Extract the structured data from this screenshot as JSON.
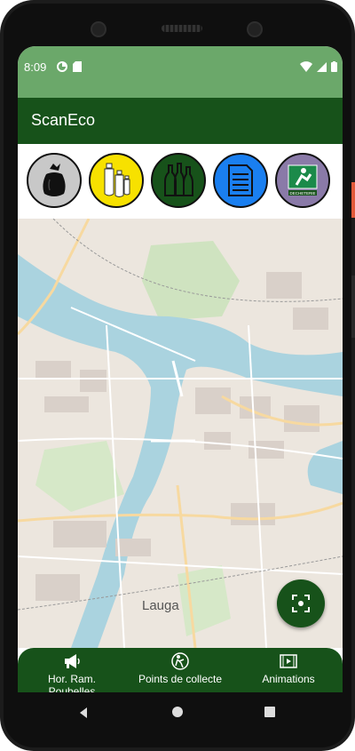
{
  "status_bar": {
    "time": "8:09",
    "background": "#6ba86a"
  },
  "app_bar": {
    "title": "ScanEco",
    "background": "#17521a"
  },
  "categories": [
    {
      "name": "ordures-menageres",
      "icon": "trash-bag-icon",
      "color": "#c8c8c8"
    },
    {
      "name": "emballages",
      "icon": "plastic-bottles-icon",
      "color": "#f7e100"
    },
    {
      "name": "verre",
      "icon": "glass-bottles-icon",
      "color": "#17521a"
    },
    {
      "name": "papier",
      "icon": "paper-document-icon",
      "color": "#1a7ff0"
    },
    {
      "name": "decheterie",
      "icon": "recycling-center-icon",
      "color": "#8a7aa8",
      "text": "DECHETERIE"
    }
  ],
  "map": {
    "label": "Lauga"
  },
  "fab": {
    "icon": "scan-icon"
  },
  "bottom_nav": {
    "items": [
      {
        "label": "Hor. Ram. Poubelles",
        "icon": "megaphone-icon"
      },
      {
        "label": "Points de collecte",
        "icon": "collection-point-icon"
      },
      {
        "label": "Animations",
        "icon": "film-icon"
      }
    ]
  }
}
